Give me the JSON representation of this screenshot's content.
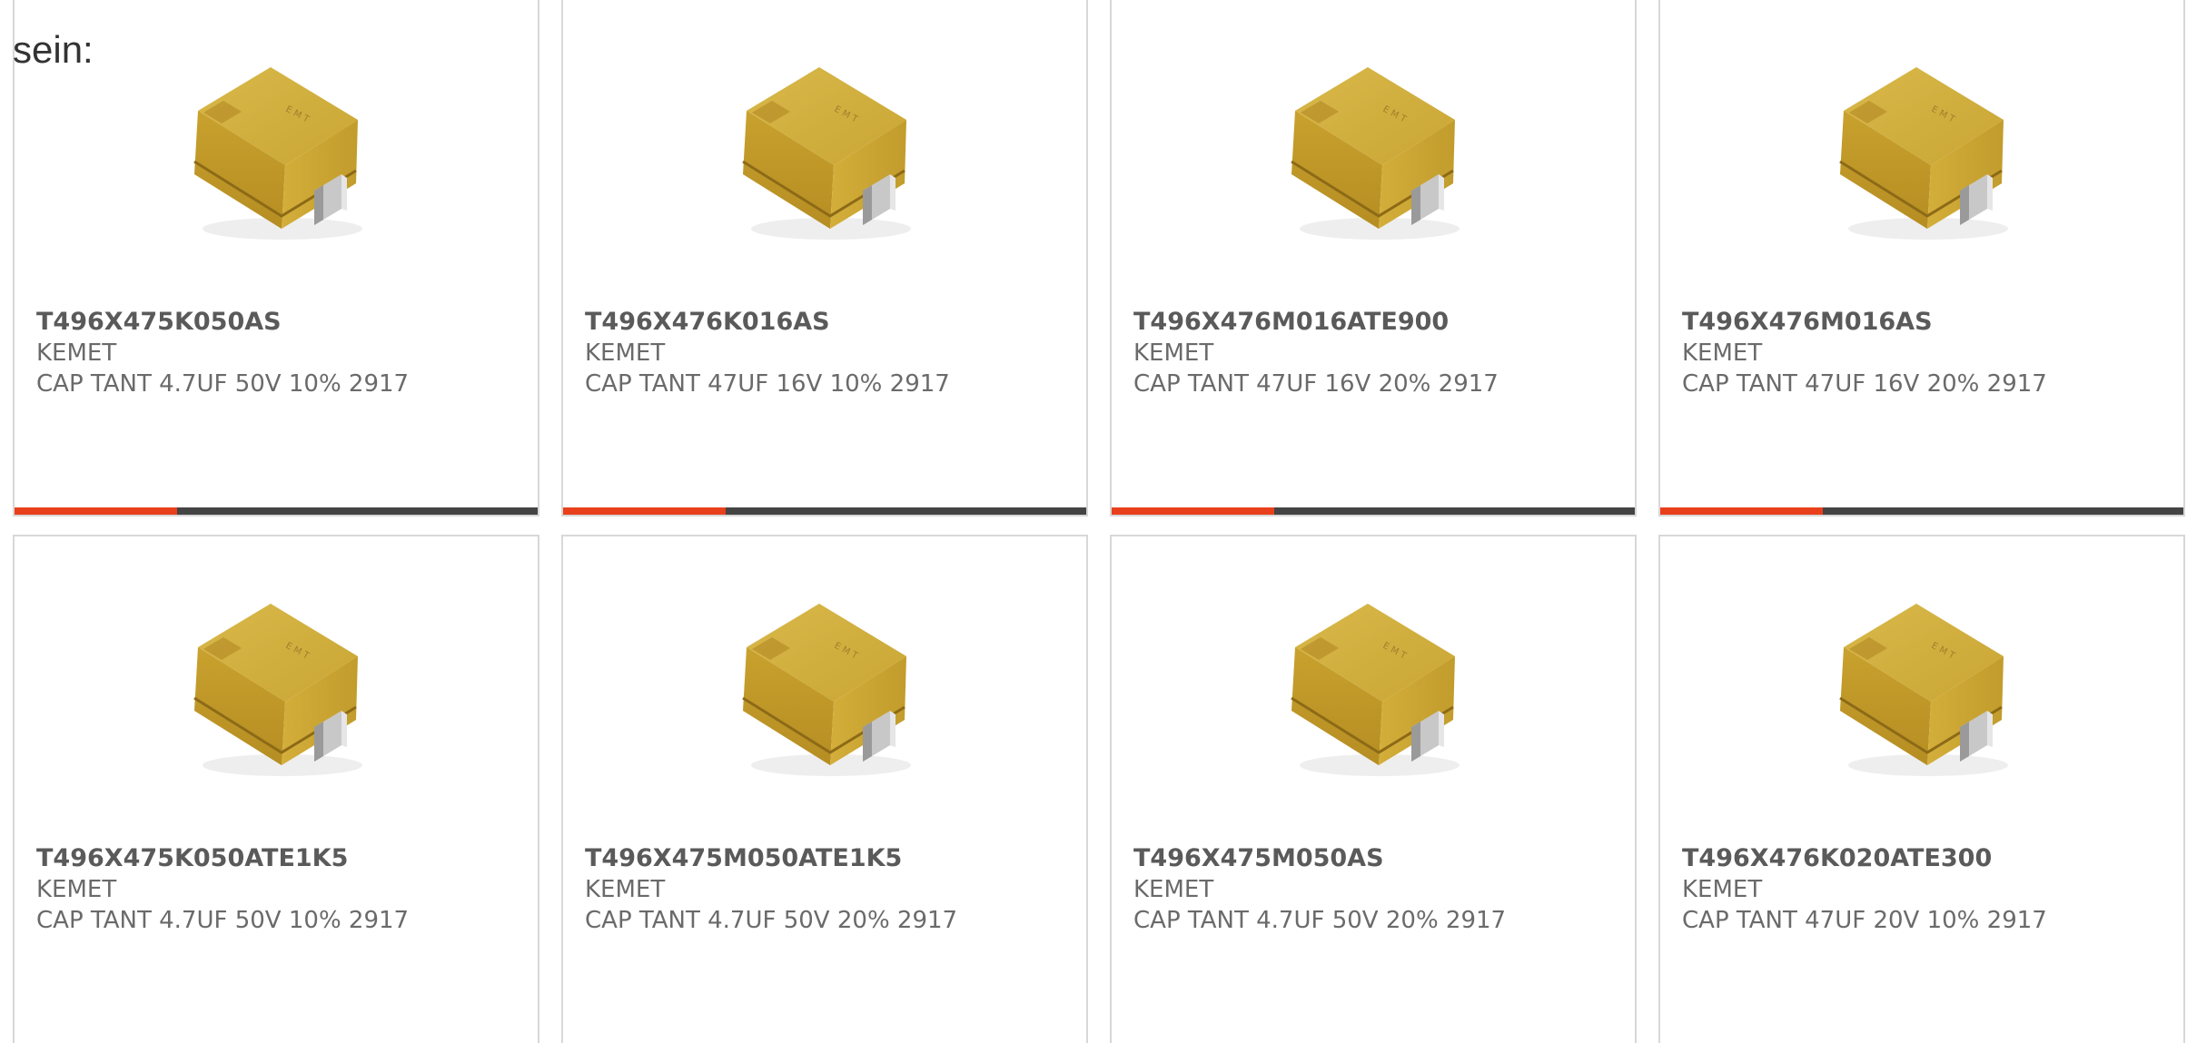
{
  "intro_text": "sein:",
  "colors": {
    "accent": "#e8401c",
    "bar_track": "#444444",
    "card_border": "#d8d8d8",
    "text": "#5a5a5a"
  },
  "products": [
    {
      "part": "T496X475K050AS",
      "manufacturer": "KEMET",
      "description": "CAP TANT 4.7UF 50V 10% 2917",
      "image_icon": "tantalum-capacitor-image",
      "progress_fraction": 0.31
    },
    {
      "part": "T496X476K016AS",
      "manufacturer": "KEMET",
      "description": "CAP TANT 47UF 16V 10% 2917",
      "image_icon": "tantalum-capacitor-image",
      "progress_fraction": 0.31
    },
    {
      "part": "T496X476M016ATE900",
      "manufacturer": "KEMET",
      "description": "CAP TANT 47UF 16V 20% 2917",
      "image_icon": "tantalum-capacitor-image",
      "progress_fraction": 0.31
    },
    {
      "part": "T496X476M016AS",
      "manufacturer": "KEMET",
      "description": "CAP TANT 47UF 16V 20% 2917",
      "image_icon": "tantalum-capacitor-image",
      "progress_fraction": 0.31
    },
    {
      "part": "T496X475K050ATE1K5",
      "manufacturer": "KEMET",
      "description": "CAP TANT 4.7UF 50V 10% 2917",
      "image_icon": "tantalum-capacitor-image"
    },
    {
      "part": "T496X475M050ATE1K5",
      "manufacturer": "KEMET",
      "description": "CAP TANT 4.7UF 50V 20% 2917",
      "image_icon": "tantalum-capacitor-image"
    },
    {
      "part": "T496X475M050AS",
      "manufacturer": "KEMET",
      "description": "CAP TANT 4.7UF 50V 20% 2917",
      "image_icon": "tantalum-capacitor-image"
    },
    {
      "part": "T496X476K020ATE300",
      "manufacturer": "KEMET",
      "description": "CAP TANT 47UF 20V 10% 2917",
      "image_icon": "tantalum-capacitor-image"
    }
  ]
}
